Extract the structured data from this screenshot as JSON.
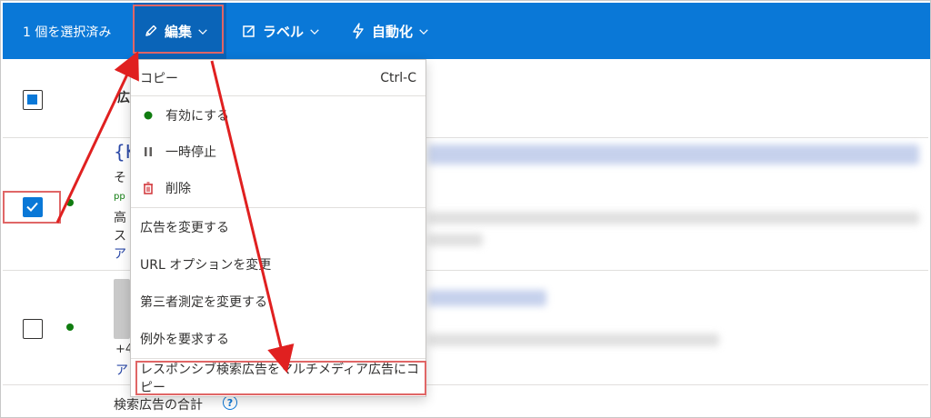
{
  "toolbar": {
    "selection_count": "1 個を選択済み",
    "edit_label": "編集",
    "label_label": "ラベル",
    "automation_label": "自動化"
  },
  "table": {
    "header_fragment": "広",
    "row1": {
      "title_fragment": "{K",
      "line1": "そ",
      "line2": "pp",
      "line3": "高",
      "line4": "ス",
      "line5": "ア"
    },
    "row2": {
      "line1": "+4",
      "line2": "ア"
    },
    "footer_label": "検索広告の合計",
    "help_glyph": "?"
  },
  "menu": {
    "copy": {
      "label": "コピー",
      "shortcut": "Ctrl-C"
    },
    "enable": "有効にする",
    "pause": "一時停止",
    "delete": "削除",
    "change_ad": "広告を変更する",
    "change_url_options": "URL オプションを変更",
    "change_third_party": "第三者測定を変更する",
    "request_exception": "例外を要求する",
    "copy_to_multimedia": "レスポンシブ検索広告をマルチメディア広告にコピー"
  },
  "colors": {
    "toolbar_bg": "#0a78d7",
    "highlight": "#e06666",
    "arrow": "#e02020",
    "status_green": "#107c10",
    "delete_red": "#d13438"
  },
  "icons": [
    "pencil-icon",
    "chevron-down-icon",
    "label-icon",
    "lightning-icon",
    "green-dot-icon",
    "pause-icon",
    "trash-icon",
    "help-icon",
    "checkmark-icon"
  ]
}
